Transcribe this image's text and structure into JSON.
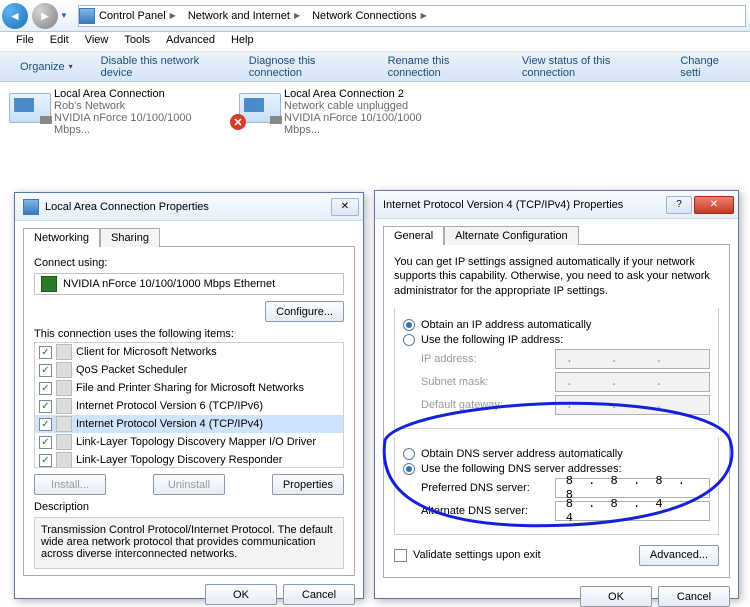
{
  "breadcrumbs": [
    "Control Panel",
    "Network and Internet",
    "Network Connections"
  ],
  "menu": {
    "file": "File",
    "edit": "Edit",
    "view": "View",
    "tools": "Tools",
    "advanced": "Advanced",
    "help": "Help"
  },
  "toolbar": {
    "organize": "Organize",
    "disable": "Disable this network device",
    "diagnose": "Diagnose this connection",
    "rename": "Rename this connection",
    "viewstatus": "View status of this connection",
    "change": "Change setti"
  },
  "connections": [
    {
      "title": "Local Area Connection",
      "sub1": "Rob's Network",
      "sub2": "NVIDIA nForce 10/100/1000 Mbps...",
      "unplugged": false
    },
    {
      "title": "Local Area Connection 2",
      "sub1": "Network cable unplugged",
      "sub2": "NVIDIA nForce 10/100/1000 Mbps...",
      "unplugged": true
    }
  ],
  "propDialog": {
    "title": "Local Area Connection Properties",
    "tabs": {
      "networking": "Networking",
      "sharing": "Sharing"
    },
    "connectUsingLabel": "Connect using:",
    "adapter": "NVIDIA nForce 10/100/1000 Mbps Ethernet",
    "configure": "Configure...",
    "itemsLabel": "This connection uses the following items:",
    "items": [
      "Client for Microsoft Networks",
      "QoS Packet Scheduler",
      "File and Printer Sharing for Microsoft Networks",
      "Internet Protocol Version 6 (TCP/IPv6)",
      "Internet Protocol Version 4 (TCP/IPv4)",
      "Link-Layer Topology Discovery Mapper I/O Driver",
      "Link-Layer Topology Discovery Responder"
    ],
    "install": "Install...",
    "uninstall": "Uninstall",
    "properties": "Properties",
    "descLabel": "Description",
    "descText": "Transmission Control Protocol/Internet Protocol. The default wide area network protocol that provides communication across diverse interconnected networks.",
    "ok": "OK",
    "cancel": "Cancel"
  },
  "ipv4Dialog": {
    "title": "Internet Protocol Version 4 (TCP/IPv4) Properties",
    "tabs": {
      "general": "General",
      "alt": "Alternate Configuration"
    },
    "intro": "You can get IP settings assigned automatically if your network supports this capability. Otherwise, you need to ask your network administrator for the appropriate IP settings.",
    "obtainIP": "Obtain an IP address automatically",
    "useIP": "Use the following IP address:",
    "ipaddr": "IP address:",
    "subnet": "Subnet mask:",
    "gateway": "Default gateway:",
    "obtainDNS": "Obtain DNS server address automatically",
    "useDNS": "Use the following DNS server addresses:",
    "prefDNS": "Preferred DNS server:",
    "altDNS": "Alternate DNS server:",
    "prefDNSval": "8 . 8 . 8 . 8",
    "altDNSval": "8 . 8 . 4 . 4",
    "validate": "Validate settings upon exit",
    "advanced": "Advanced...",
    "ok": "OK",
    "cancel": "Cancel"
  }
}
